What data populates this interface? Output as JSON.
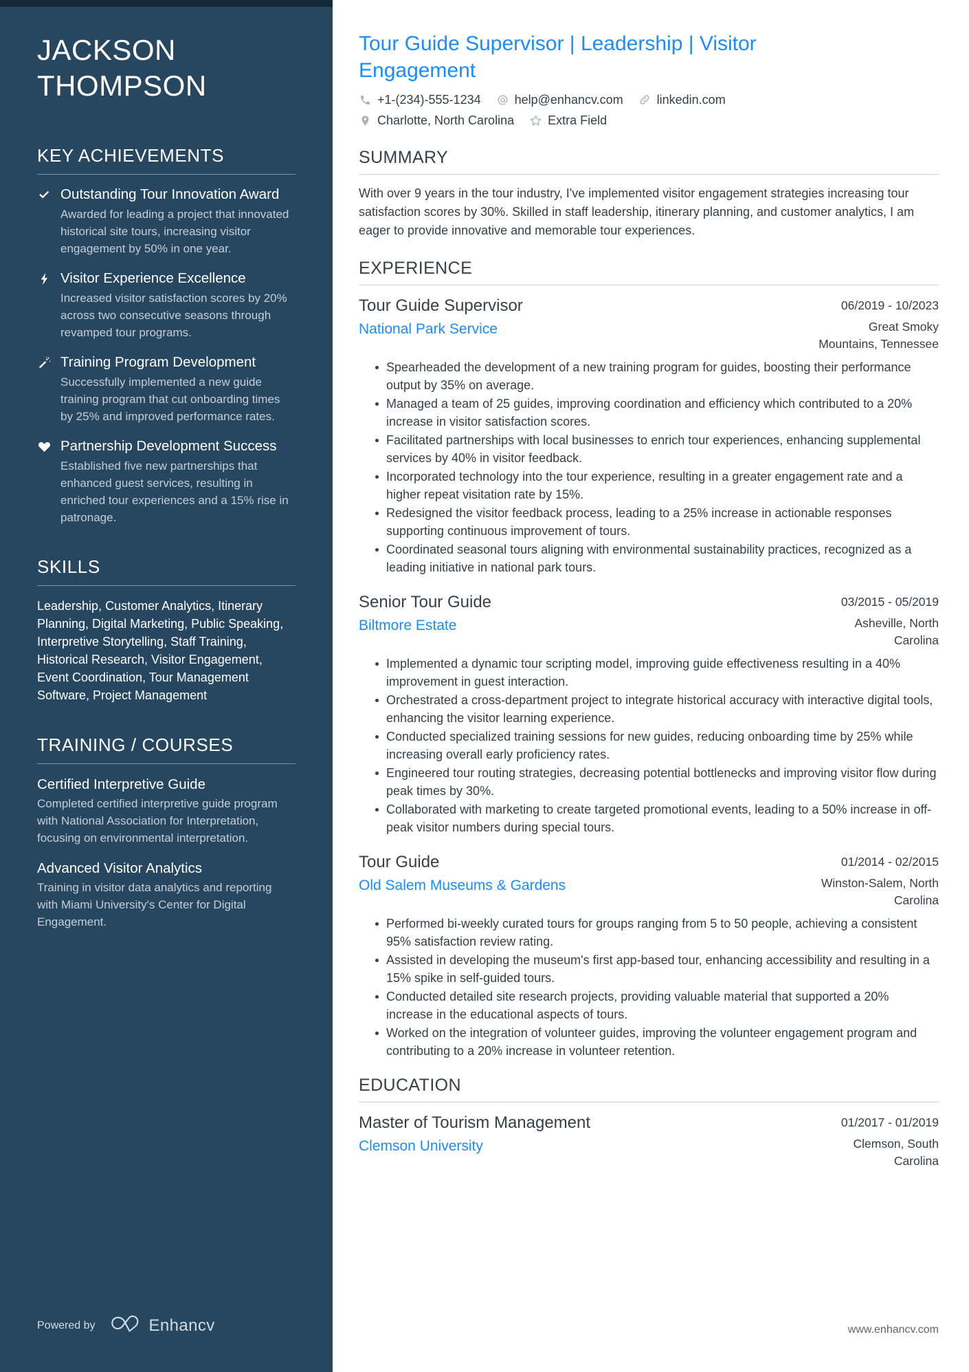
{
  "colors": {
    "sidebar_bg": "#27465f",
    "sidebar_topbar": "#16293a",
    "accent_blue": "#1a8cff",
    "body_text": "#37404a",
    "muted_text": "#c5ced6"
  },
  "sidebar": {
    "name": {
      "first": "JACKSON",
      "last": "THOMPSON"
    },
    "achievements": {
      "heading": "KEY ACHIEVEMENTS",
      "items": [
        {
          "icon": "check-icon",
          "title": "Outstanding Tour Innovation Award",
          "description": "Awarded for leading a project that innovated historical site tours, increasing visitor engagement by 50% in one year."
        },
        {
          "icon": "lightning-bolt-icon",
          "title": "Visitor Experience Excellence",
          "description": "Increased visitor satisfaction scores by 20% across two consecutive seasons through revamped tour programs."
        },
        {
          "icon": "magic-wand-icon",
          "title": "Training Program Development",
          "description": "Successfully implemented a new guide training program that cut onboarding times by 25% and improved performance rates."
        },
        {
          "icon": "heart-icon",
          "title": "Partnership Development Success",
          "description": "Established five new partnerships that enhanced guest services, resulting in enriched tour experiences and a 15% rise in patronage."
        }
      ]
    },
    "skills": {
      "heading": "SKILLS",
      "text": "Leadership, Customer Analytics, Itinerary Planning, Digital Marketing, Public Speaking, Interpretive Storytelling, Staff Training, Historical Research, Visitor Engagement, Event Coordination, Tour Management Software, Project Management"
    },
    "training": {
      "heading": "TRAINING / COURSES",
      "items": [
        {
          "title": "Certified Interpretive Guide",
          "description": "Completed certified interpretive guide program with National Association for Interpretation, focusing on environmental interpretation."
        },
        {
          "title": "Advanced Visitor Analytics",
          "description": "Training in visitor data analytics and reporting with Miami University's Center for Digital Engagement."
        }
      ]
    },
    "powered_by": {
      "label": "Powered by",
      "brand": "Enhancv"
    }
  },
  "main": {
    "headline": "Tour Guide Supervisor | Leadership | Visitor Engagement",
    "contacts": {
      "row1": [
        {
          "icon": "phone-icon",
          "value": "+1-(234)-555-1234"
        },
        {
          "icon": "at-email-icon",
          "value": "help@enhancv.com"
        },
        {
          "icon": "link-icon",
          "value": "linkedin.com"
        }
      ],
      "row2": [
        {
          "icon": "location-pin-icon",
          "value": "Charlotte, North Carolina"
        },
        {
          "icon": "star-icon",
          "value": "Extra Field"
        }
      ]
    },
    "summary": {
      "heading": "SUMMARY",
      "text": "With over 9 years in the tour industry, I've implemented visitor engagement strategies increasing tour satisfaction scores by 30%. Skilled in staff leadership, itinerary planning, and customer analytics, I am eager to provide innovative and memorable tour experiences."
    },
    "experience": {
      "heading": "EXPERIENCE",
      "entries": [
        {
          "role": "Tour Guide Supervisor",
          "organization": "National Park Service",
          "dates": "06/2019 - 10/2023",
          "location": "Great Smoky Mountains, Tennessee",
          "bullets": [
            "Spearheaded the development of a new training program for guides, boosting their performance output by 35% on average.",
            "Managed a team of 25 guides, improving coordination and efficiency which contributed to a 20% increase in visitor satisfaction scores.",
            "Facilitated partnerships with local businesses to enrich tour experiences, enhancing supplemental services by 40% in visitor feedback.",
            "Incorporated technology into the tour experience, resulting in a greater engagement rate and a higher repeat visitation rate by 15%.",
            "Redesigned the visitor feedback process, leading to a 25% increase in actionable responses supporting continuous improvement of tours.",
            "Coordinated seasonal tours aligning with environmental sustainability practices, recognized as a leading initiative in national park tours."
          ]
        },
        {
          "role": "Senior Tour Guide",
          "organization": "Biltmore Estate",
          "dates": "03/2015 - 05/2019",
          "location": "Asheville, North Carolina",
          "bullets": [
            "Implemented a dynamic tour scripting model, improving guide effectiveness resulting in a 40% improvement in guest interaction.",
            "Orchestrated a cross-department project to integrate historical accuracy with interactive digital tools, enhancing the visitor learning experience.",
            "Conducted specialized training sessions for new guides, reducing onboarding time by 25% while increasing overall early proficiency rates.",
            "Engineered tour routing strategies, decreasing potential bottlenecks and improving visitor flow during peak times by 30%.",
            "Collaborated with marketing to create targeted promotional events, leading to a 50% increase in off-peak visitor numbers during special tours."
          ]
        },
        {
          "role": "Tour Guide",
          "organization": "Old Salem Museums & Gardens",
          "dates": "01/2014 - 02/2015",
          "location": "Winston-Salem, North Carolina",
          "bullets": [
            "Performed bi-weekly curated tours for groups ranging from 5 to 50 people, achieving a consistent 95% satisfaction review rating.",
            "Assisted in developing the museum's first app-based tour, enhancing accessibility and resulting in a 15% spike in self-guided tours.",
            "Conducted detailed site research projects, providing valuable material that supported a 20% increase in the educational aspects of tours.",
            "Worked on the integration of volunteer guides, improving the volunteer engagement program and contributing to a 20% increase in volunteer retention."
          ]
        }
      ]
    },
    "education": {
      "heading": "EDUCATION",
      "entries": [
        {
          "degree": "Master of Tourism Management",
          "institution": "Clemson University",
          "dates": "01/2017 - 01/2019",
          "location": "Clemson, South Carolina"
        }
      ]
    },
    "footer_url": "www.enhancv.com"
  }
}
